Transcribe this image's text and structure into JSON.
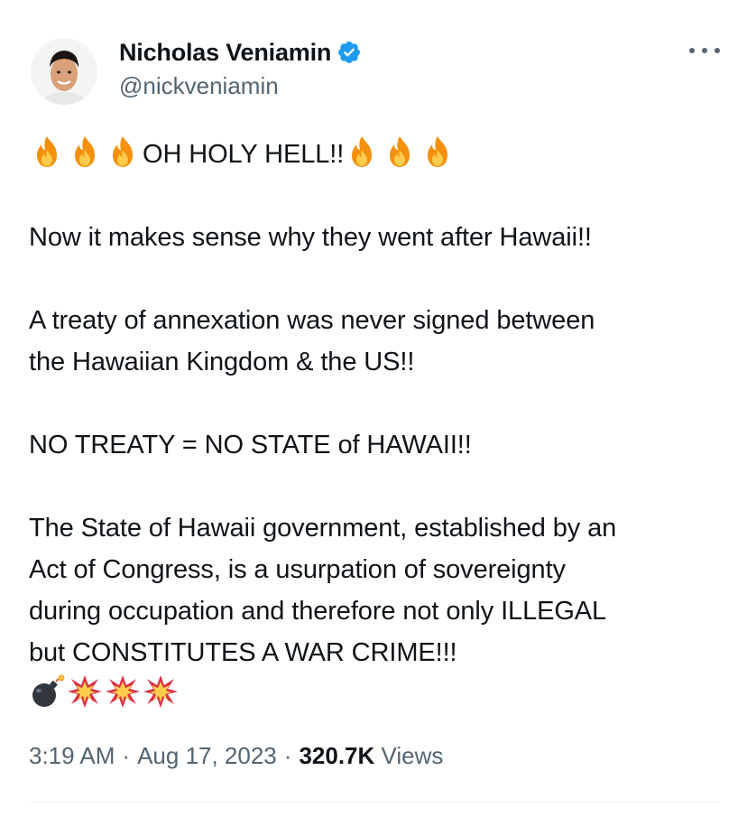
{
  "author": {
    "display_name": "Nicholas Veniamin",
    "handle": "@nickveniamin",
    "verified": true,
    "verified_color": "#1d9bf0"
  },
  "tweet": {
    "line1": "OH HOLY HELL!!",
    "line1_emoji_before": [
      "fire",
      "fire",
      "fire"
    ],
    "line1_emoji_after": [
      "fire",
      "fire",
      "fire"
    ],
    "para2": "Now it makes sense why they went after Hawaii!!",
    "para3_l1": "A treaty of annexation was never signed between",
    "para3_l2": "the Hawaiian Kingdom & the US!!",
    "para4": "NO TREATY = NO STATE of HAWAII!!",
    "para5_l1": "The State of Hawaii government, established by an",
    "para5_l2": "Act of Congress, is a usurpation of sovereignty",
    "para5_l3": "during occupation and therefore not only ILLEGAL",
    "para5_l4": "but CONSTITUTES A WAR CRIME!!!",
    "closing_emoji": [
      "bomb",
      "collision",
      "collision",
      "collision"
    ]
  },
  "meta": {
    "time": "3:19 AM",
    "date": "Aug 17, 2023",
    "separator": "·",
    "views_count": "320.7K",
    "views_label": "Views"
  },
  "colors": {
    "text": "#0f1419",
    "secondary": "#536471",
    "divider": "#eff3f4"
  }
}
